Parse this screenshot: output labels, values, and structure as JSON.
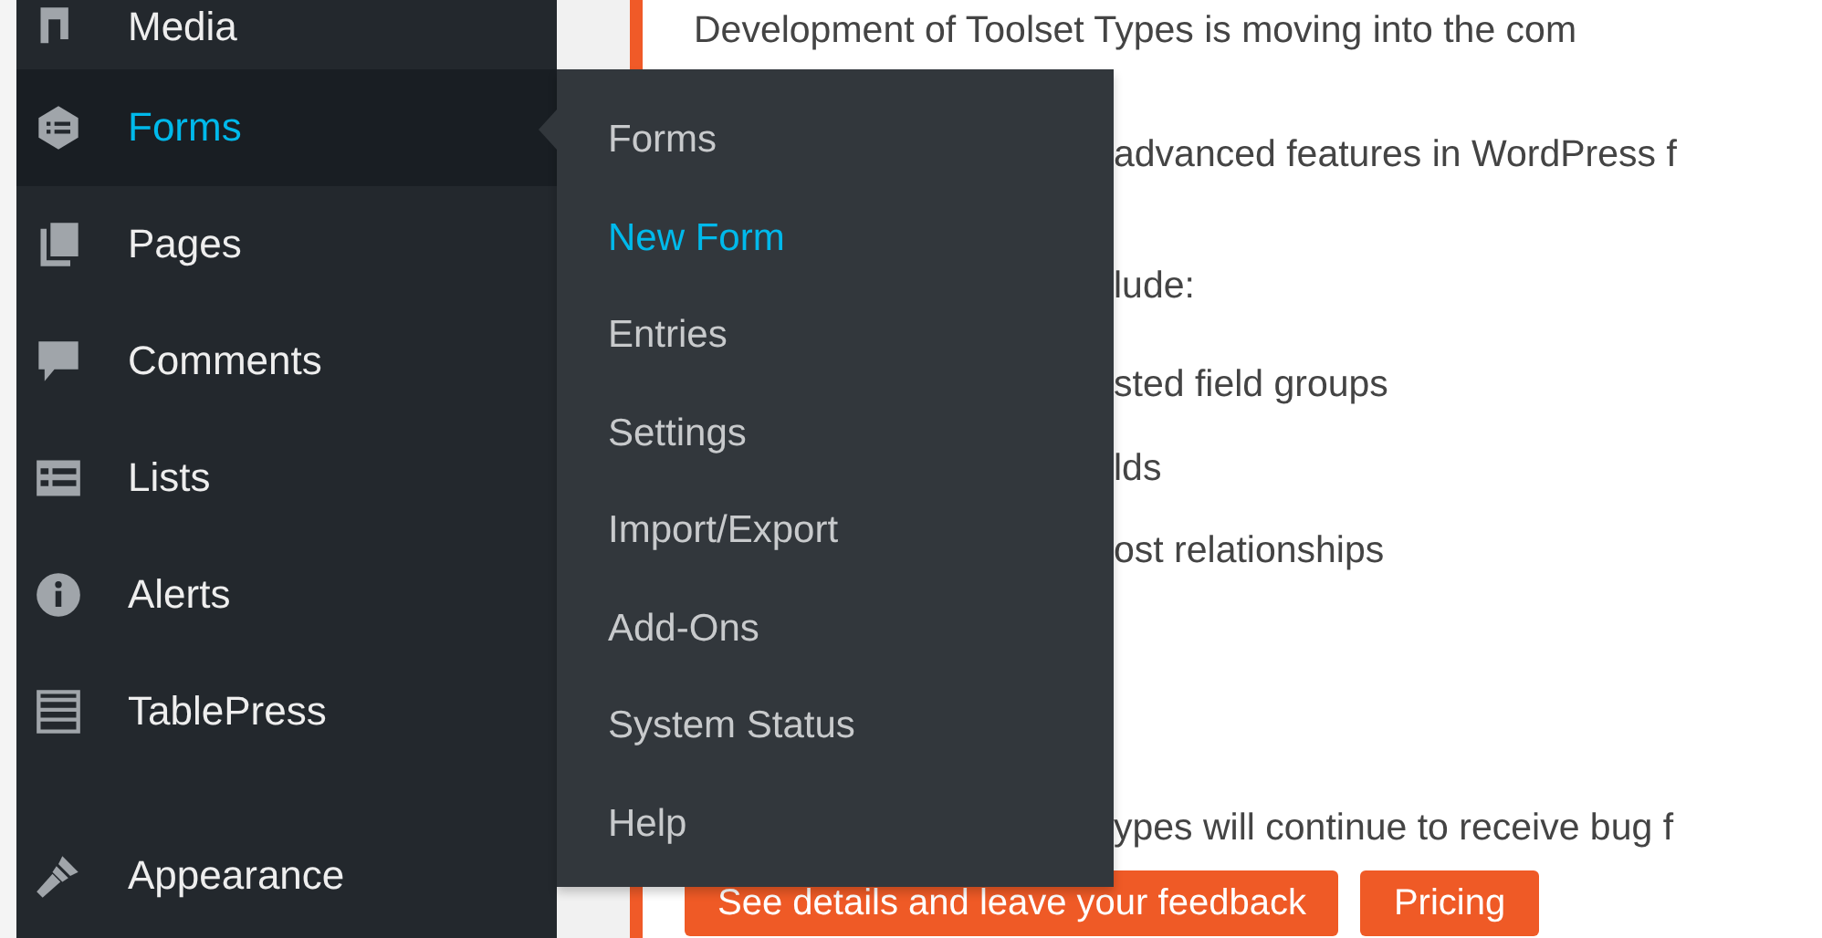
{
  "sidebar": {
    "groups": [
      [
        {
          "label": "Media",
          "selected": false
        },
        {
          "label": "Forms",
          "selected": true
        },
        {
          "label": "Pages",
          "selected": false
        },
        {
          "label": "Comments",
          "selected": false
        },
        {
          "label": "Lists",
          "selected": false
        },
        {
          "label": "Alerts",
          "selected": false
        },
        {
          "label": "TablePress",
          "selected": false
        }
      ],
      [
        {
          "label": "Appearance",
          "selected": false
        }
      ]
    ]
  },
  "submenu": {
    "items": [
      {
        "label": "Forms",
        "selected": false
      },
      {
        "label": "New Form",
        "selected": true
      },
      {
        "label": "Entries",
        "selected": false
      },
      {
        "label": "Settings",
        "selected": false
      },
      {
        "label": "Import/Export",
        "selected": false
      },
      {
        "label": "Add-Ons",
        "selected": false
      },
      {
        "label": "System Status",
        "selected": false
      },
      {
        "label": "Help",
        "selected": false
      }
    ]
  },
  "notice": {
    "heading": "Development of Toolset Types is moving into the com",
    "lines": [
      "advanced features in WordPress f",
      "lude:",
      "sted field groups",
      "lds",
      "ost relationships",
      "ypes will continue to receive bug f"
    ],
    "buttons": [
      "See details and leave your feedback",
      "Pricing"
    ]
  }
}
